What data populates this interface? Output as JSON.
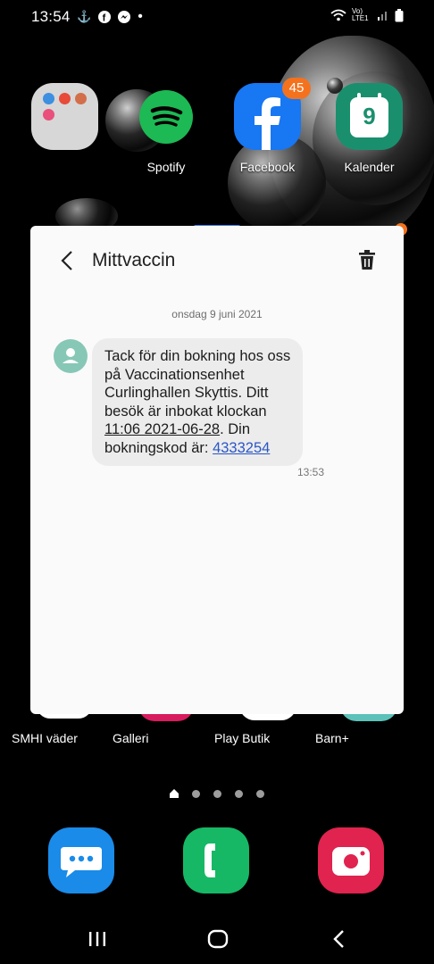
{
  "status_bar": {
    "time": "13:54",
    "right_text": "Vo) LTE1"
  },
  "home_apps_top": [
    {
      "name": "Spotify",
      "label": "Spotify"
    },
    {
      "name": "Facebook",
      "label": "Facebook",
      "badge": "45"
    },
    {
      "name": "Kalender",
      "label": "Kalender",
      "day": "9"
    }
  ],
  "home_apps_bottom": [
    {
      "label": "SMHI väder"
    },
    {
      "label": "Galleri"
    },
    {
      "label": "Play Butik"
    },
    {
      "label": "Barn+"
    }
  ],
  "message_card": {
    "title": "Mittvaccin",
    "date": "onsdag 9 juni 2021",
    "message": {
      "part1": "Tack för din bokning hos oss på Vaccinationsenhet Curlinghallen Skyttis. Ditt besök är inbokat klockan ",
      "datetime_link": "11:06 2021-06-28",
      "part2": ". Din bokningskod är: ",
      "code_link": "4333254"
    },
    "time": "13:53"
  },
  "page_indicator": {
    "count": 5,
    "active": 0
  },
  "colors": {
    "accent_handle": "#2f7be0",
    "spotify": "#1db954",
    "facebook": "#1877f2",
    "calendar": "#1a8f6e",
    "messages": "#1a8be8",
    "phone": "#16b865",
    "camera": "#e0234f",
    "avatar": "#87c7b5",
    "link": "#2a56c6"
  }
}
